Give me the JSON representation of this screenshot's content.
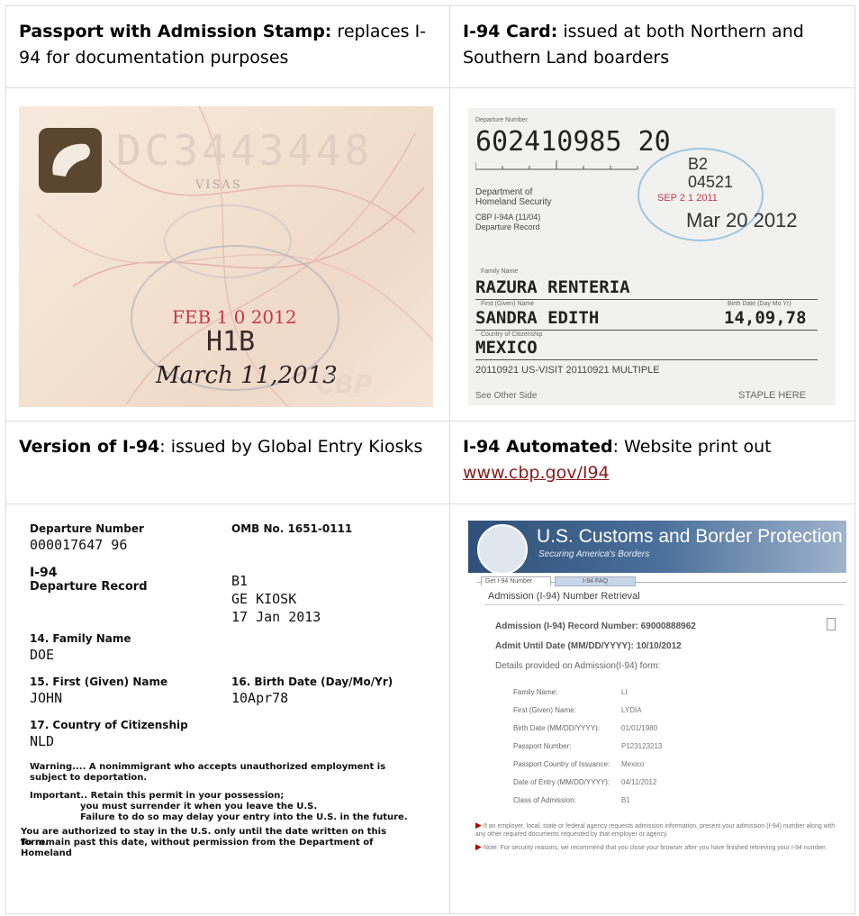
{
  "cells": {
    "passport": {
      "title": "Passport with Admission Stamp:",
      "text": " replaces I-94 for documentation purposes",
      "image": {
        "number": "DC3443448",
        "visas": "VISAS",
        "stamp_date": "FEB 1 0 2012",
        "class": "H1B",
        "handwritten": "March 11,2013",
        "watermark": "CBP"
      }
    },
    "i94card": {
      "title": "I-94 Card:",
      "text": " issued at both Northern and Southern Land boarders",
      "image": {
        "dep_label": "Departure Number",
        "number": "602410985 20",
        "agency": "Department of\nHomeland Security",
        "form": "CBP I-94A (11/04)\nDeparture Record",
        "class": "B2",
        "port": "04521",
        "stamp": "SEP 2 1 2011",
        "until": "Mar 20 2012",
        "family_label": "Family Name",
        "family": "RAZURA RENTERIA",
        "given_label": "First (Given) Name",
        "given": "SANDRA EDITH",
        "birth_label": "Birth Date (Day Mo Yr)",
        "birth": "14,09,78",
        "country_label": "Country of Citizenship",
        "country": "MEXICO",
        "visit": "20110921 US-VISIT 20110921 MULTIPLE",
        "see_other": "See Other Side",
        "staple": "STAPLE HERE"
      }
    },
    "kiosk": {
      "title": "Version of I-94",
      "text": ": issued by Global Entry Kiosks",
      "image": {
        "dep_label": "Departure Number",
        "dep_value": "000017647 96",
        "omb": "OMB No. 1651-0111",
        "form_title": "I-94",
        "form_sub": "Departure Record",
        "class": "B1",
        "kiosk": "GE KIOSK",
        "date": "17 Jan 2013",
        "family_label": "14. Family Name",
        "family": "DOE",
        "first_label": "15. First (Given) Name",
        "first": "JOHN",
        "birth_label": "16. Birth Date (Day/Mo/Yr)",
        "birth": "10Apr78",
        "country_label": "17. Country of Citizenship",
        "country": "NLD",
        "warning": "Warning.... A nonimmigrant who accepts unauthorized employment is subject to deportation.",
        "important1": "Important.. Retain this permit in your possession;",
        "important2": "you must surrender it when you leave the U.S.",
        "important3": "Failure to do so may delay your entry into the U.S. in the future.",
        "authorized": "You are authorized to stay in the U.S. only until the date written on this form.",
        "remain": "To remain past this date, without permission from the Department of Homeland"
      }
    },
    "automated": {
      "title": "I-94 Automated",
      "text": ": Website print out ",
      "link": "www.cbp.gov/I94",
      "image": {
        "banner_title": "U.S. Customs and Border Protection",
        "banner_sub": "Securing America's Borders",
        "tab1": "Get I-94 Number",
        "tab2": "I-94 FAQ",
        "heading": "Admission (I-94) Number Retrieval",
        "record": "Admission (I-94) Record Number: 69000888962",
        "admit": "Admit Until Date (MM/DD/YYYY): 10/10/2012",
        "details": "Details provided on Admission(I-94) form:",
        "fields": [
          {
            "label": "Family Name:",
            "value": "LI"
          },
          {
            "label": "First (Given) Name:",
            "value": "LYDIA"
          },
          {
            "label": "Birth Date (MM/DD/YYYY):",
            "value": "01/01/1980"
          },
          {
            "label": "Passport Number:",
            "value": "P123123213"
          },
          {
            "label": "Passport Country of Issuance:",
            "value": "Mexico"
          },
          {
            "label": "Date of Entry (MM/DD/YYYY):",
            "value": "04/11/2012"
          },
          {
            "label": "Class of Admission:",
            "value": "B1"
          }
        ],
        "note1": "If an employer, local, state or federal agency requests admission information, present your admission (I-94) number along with any other required documents requested by that employer or agency.",
        "note2": "Note: For security reasons, we recommend that you close your browser after you have finished retrieving your I-94 number."
      }
    }
  }
}
